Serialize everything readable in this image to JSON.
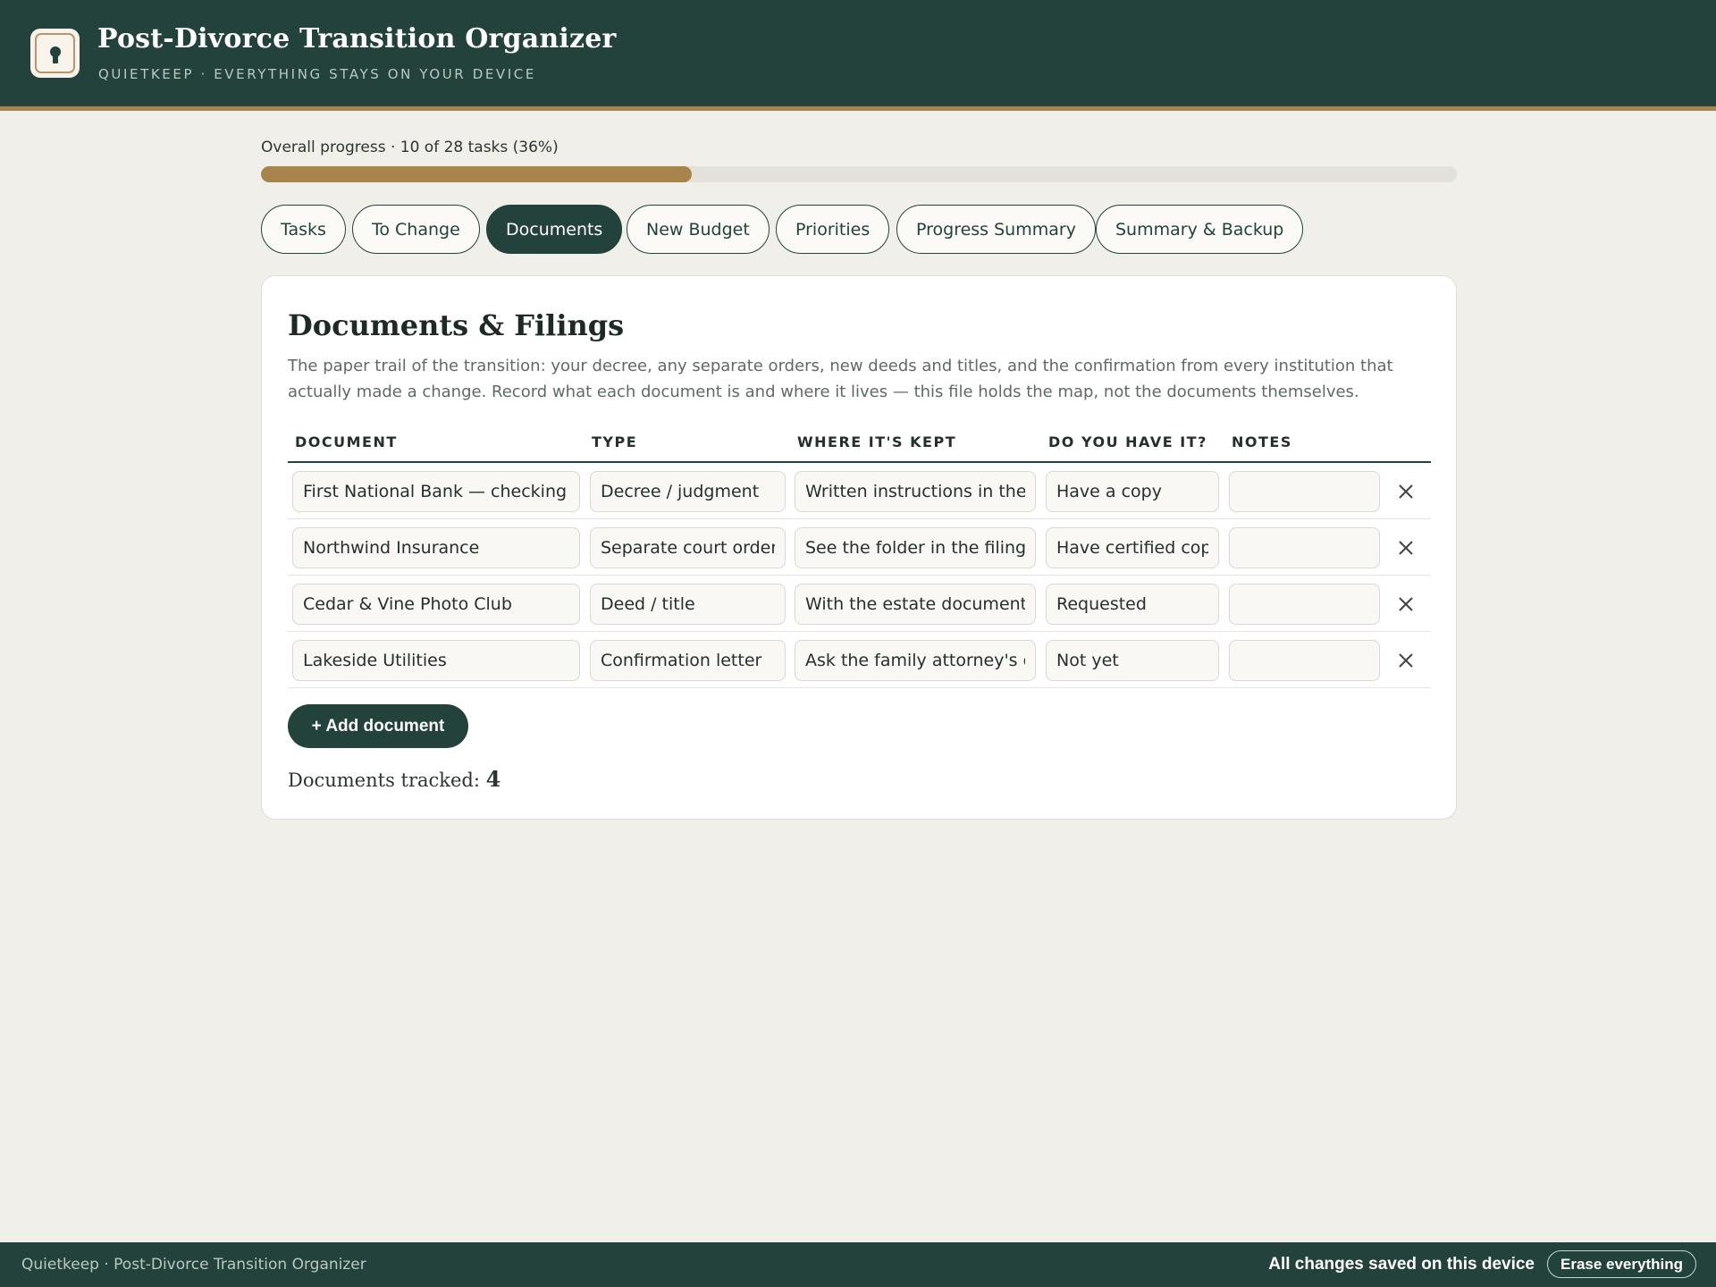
{
  "header": {
    "title": "Post-Divorce Transition Organizer",
    "subtitle": "QUIETKEEP · EVERYTHING STAYS ON YOUR DEVICE",
    "logo_icon": "keyhole-icon"
  },
  "progress": {
    "label": "Overall progress · 10 of 28 tasks (36%)",
    "completed": 10,
    "total": 28,
    "percent": 36
  },
  "tabs": [
    {
      "label": "Tasks",
      "active": false
    },
    {
      "label": "To Change",
      "active": false
    },
    {
      "label": "Documents",
      "active": true
    },
    {
      "label": "New Budget",
      "active": false
    },
    {
      "label": "Priorities",
      "active": false
    },
    {
      "label": "Progress Summary",
      "active": false
    },
    {
      "label": "Summary & Backup",
      "active": false
    }
  ],
  "documents": {
    "title": "Documents & Filings",
    "description": "The paper trail of the transition: your decree, any separate orders, new deeds and titles, and the confirmation from every institution that actually made a change. Record what each document is and where it lives — this file holds the map, not the documents themselves.",
    "columns": [
      "DOCUMENT",
      "TYPE",
      "WHERE IT'S KEPT",
      "DO YOU HAVE IT?",
      "NOTES"
    ],
    "rows": [
      {
        "document": "First National Bank — checking",
        "type": "Decree / judgment",
        "where": "Written instructions in the home safe",
        "have": "Have a copy",
        "notes": ""
      },
      {
        "document": "Northwind Insurance",
        "type": "Separate court order",
        "where": "See the folder in the filing cabinet",
        "have": "Have certified copy",
        "notes": ""
      },
      {
        "document": "Cedar & Vine Photo Club",
        "type": "Deed / title",
        "where": "With the estate documents",
        "have": "Requested",
        "notes": ""
      },
      {
        "document": "Lakeside Utilities",
        "type": "Confirmation letter",
        "where": "Ask the family attorney's office",
        "have": "Not yet",
        "notes": ""
      }
    ],
    "add_label": "+ Add document",
    "tracked_label": "Documents tracked:",
    "tracked_count": "4"
  },
  "footer": {
    "left": "Quietkeep · Post-Divorce Transition Organizer",
    "status": "All changes saved on this device",
    "erase_label": "Erase everything"
  },
  "colors": {
    "primary": "#24423c",
    "accent": "#a8834c",
    "background": "#f1efea"
  }
}
